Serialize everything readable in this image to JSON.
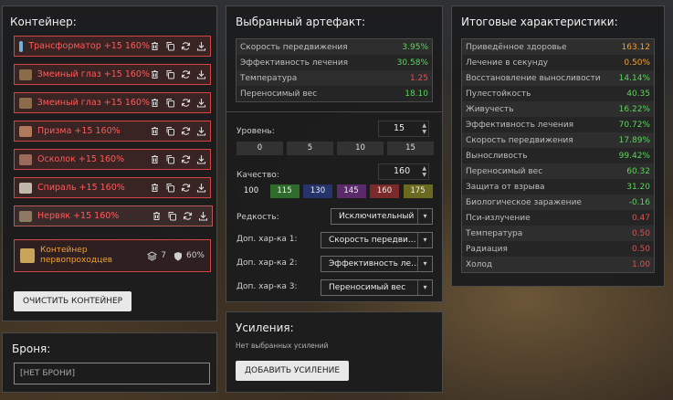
{
  "container": {
    "title": "Контейнер:",
    "artifacts": [
      {
        "name": "Трансформатор +15 160%",
        "icon_color": "#6fb3d8"
      },
      {
        "name": "Змеиный глаз +15 160%",
        "icon_color": "#8a6b4a"
      },
      {
        "name": "Змеиный глаз +15 160%",
        "icon_color": "#8a6b4a"
      },
      {
        "name": "Призма +15 160%",
        "icon_color": "#b07a5a"
      },
      {
        "name": "Осколок +15 160%",
        "icon_color": "#9c6a5a"
      },
      {
        "name": "Спираль +15 160%",
        "icon_color": "#c0b8a8"
      },
      {
        "name": "Нервяк +15 160%",
        "icon_color": "#8c7b62"
      }
    ],
    "pioneer": {
      "name_line1": "Контейнер",
      "name_line2": "первопроходцев",
      "slots": "7",
      "protection": "60%"
    },
    "clear_label": "ОЧИСТИТЬ КОНТЕЙНЕР"
  },
  "armor": {
    "title": "Броня:",
    "value": "[НЕТ БРОНИ]"
  },
  "selected": {
    "title": "Выбранный артефакт:",
    "stats": [
      {
        "label": "Скорость передвижения",
        "value": "3.95%",
        "color": "#5ad65a"
      },
      {
        "label": "Эффективность лечения",
        "value": "30.58%",
        "color": "#5ad65a"
      },
      {
        "label": "Температура",
        "value": "1.25",
        "color": "#e05050"
      },
      {
        "label": "Переносимый вес",
        "value": "18.10",
        "color": "#5ad65a"
      }
    ],
    "level_label": "Уровень:",
    "level_value": "15",
    "level_presets": [
      "0",
      "5",
      "10",
      "15"
    ],
    "quality_label": "Качество:",
    "quality_value": "160",
    "quality_presets": [
      {
        "label": "100",
        "color": "#1d1d1d"
      },
      {
        "label": "115",
        "color": "#2f6b2a"
      },
      {
        "label": "130",
        "color": "#25346a"
      },
      {
        "label": "145",
        "color": "#5a2a6a"
      },
      {
        "label": "160",
        "color": "#7a2a2a"
      },
      {
        "label": "175",
        "color": "#6a6a20"
      }
    ],
    "rarity_label": "Редкость:",
    "rarity_value": "Исключительный",
    "extra": [
      {
        "label": "Доп. хар-ка 1:",
        "value": "Скорость передви..."
      },
      {
        "label": "Доп. хар-ка 2:",
        "value": "Эффективность ле..."
      },
      {
        "label": "Доп. хар-ка 3:",
        "value": "Переносимый вес"
      }
    ]
  },
  "boosts": {
    "title": "Усиления:",
    "empty": "Нет выбранных усилений",
    "add_label": "ДОБАВИТЬ УСИЛЕНИЕ"
  },
  "totals": {
    "title": "Итоговые характеристики:",
    "rows": [
      {
        "label": "Приведённое здоровье",
        "value": "163.12",
        "color": "#f0a030"
      },
      {
        "label": "Лечение в секунду",
        "value": "0.50%",
        "color": "#f0a030"
      },
      {
        "label": "Восстановление выносливости",
        "value": "14.14%",
        "color": "#5ad65a"
      },
      {
        "label": "Пулестойкость",
        "value": "40.35",
        "color": "#5ad65a"
      },
      {
        "label": "Живучесть",
        "value": "16.22%",
        "color": "#5ad65a"
      },
      {
        "label": "Эффективность лечения",
        "value": "70.72%",
        "color": "#5ad65a"
      },
      {
        "label": "Скорость передвижения",
        "value": "17.89%",
        "color": "#5ad65a"
      },
      {
        "label": "Выносливость",
        "value": "99.42%",
        "color": "#5ad65a"
      },
      {
        "label": "Переносимый вес",
        "value": "60.32",
        "color": "#5ad65a"
      },
      {
        "label": "Защита от взрыва",
        "value": "31.20",
        "color": "#5ad65a"
      },
      {
        "label": "Биологическое заражение",
        "value": "-0.16",
        "color": "#5ad65a"
      },
      {
        "label": "Пси-излучение",
        "value": "0.47",
        "color": "#e05050"
      },
      {
        "label": "Температура",
        "value": "0.50",
        "color": "#e05050"
      },
      {
        "label": "Радиация",
        "value": "0.50",
        "color": "#e05050"
      },
      {
        "label": "Холод",
        "value": "1.00",
        "color": "#e05050"
      }
    ]
  }
}
